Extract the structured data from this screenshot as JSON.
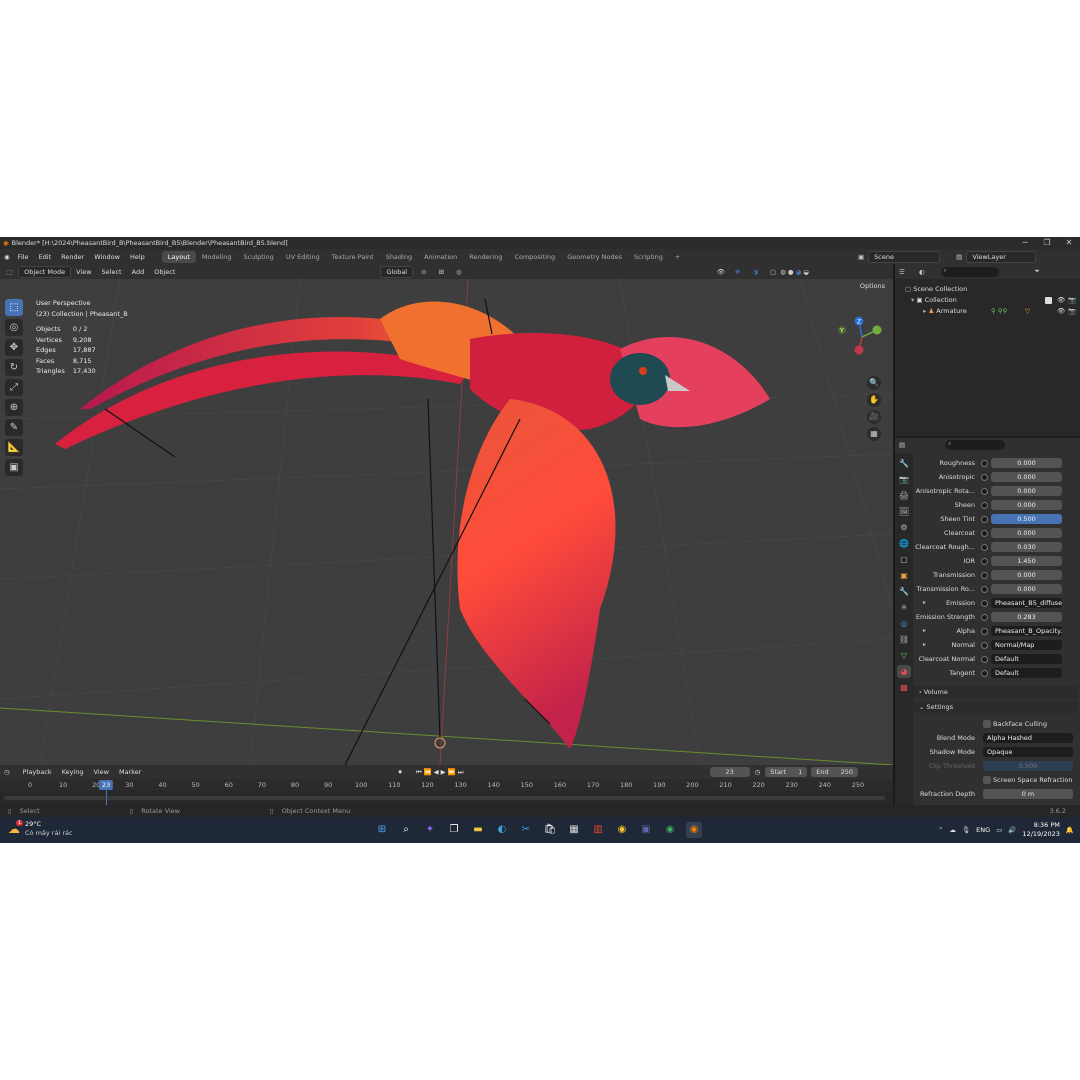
{
  "window": {
    "title": "Blender* [H:\\2024\\PheasantBird_B\\PheasantBird_B5\\Blender\\PheasantBird_B5.blend]",
    "minimize": "─",
    "maximize": "❐",
    "close": "✕"
  },
  "menu": [
    "File",
    "Edit",
    "Render",
    "Window",
    "Help"
  ],
  "workspaces": [
    "Layout",
    "Modeling",
    "Sculpting",
    "UV Editing",
    "Texture Paint",
    "Shading",
    "Animation",
    "Rendering",
    "Compositing",
    "Geometry Nodes",
    "Scripting"
  ],
  "active_workspace": "Layout",
  "add_workspace": "+",
  "scene": {
    "label": "Scene",
    "view_layer": "ViewLayer"
  },
  "viewport_header": {
    "mode": "Object Mode",
    "menus": [
      "View",
      "Select",
      "Add",
      "Object"
    ],
    "orientation": "Global",
    "options": "Options"
  },
  "viewport": {
    "view_name": "User Perspective",
    "collection_line": "(23) Collection | Pheasant_B",
    "stats": [
      {
        "label": "Objects",
        "value": "0 / 2"
      },
      {
        "label": "Vertices",
        "value": "9,208"
      },
      {
        "label": "Edges",
        "value": "17,887"
      },
      {
        "label": "Faces",
        "value": "8,715"
      },
      {
        "label": "Triangles",
        "value": "17,430"
      }
    ],
    "gizmo_axes": {
      "x": "X",
      "y": "Y",
      "z": "Z"
    }
  },
  "outliner": {
    "scene_collection": "Scene Collection",
    "collection": "Collection",
    "armature": "Armature"
  },
  "properties": [
    {
      "label": "Roughness",
      "value": "0.000"
    },
    {
      "label": "Anisotropic",
      "value": "0.000"
    },
    {
      "label": "Anisotropic Rota...",
      "value": "0.000"
    },
    {
      "label": "Sheen",
      "value": "0.000"
    },
    {
      "label": "Sheen Tint",
      "value": "0.500",
      "style": "blue"
    },
    {
      "label": "Clearcoat",
      "value": "0.000"
    },
    {
      "label": "Clearcoat Rough...",
      "value": "0.030"
    },
    {
      "label": "IOR",
      "value": "1.450"
    },
    {
      "label": "Transmission",
      "value": "0.000"
    },
    {
      "label": "Transmission Ro...",
      "value": "0.000"
    },
    {
      "label": "Emission",
      "value": "Pheasant_B5_diffuseOr...",
      "style": "dark",
      "expand": true
    },
    {
      "label": "Emission Strength",
      "value": "0.283"
    },
    {
      "label": "Alpha",
      "value": "Pheasant_B_Opacity.png",
      "style": "dark",
      "expand": true
    },
    {
      "label": "Normal",
      "value": "Normal/Map",
      "style": "dark",
      "expand": true
    },
    {
      "label": "Clearcoat Normal",
      "value": "Default",
      "style": "dark"
    },
    {
      "label": "Tangent",
      "value": "Default",
      "style": "dark"
    }
  ],
  "sections": {
    "volume": "Volume",
    "settings": "Settings"
  },
  "settings": {
    "backface_culling": "Backface Culling",
    "blend_mode_label": "Blend Mode",
    "blend_mode": "Alpha Hashed",
    "shadow_mode_label": "Shadow Mode",
    "shadow_mode": "Opaque",
    "clip_label": "Clip Threshold",
    "clip_value": "0.500",
    "ssr": "Screen Space Refraction",
    "refraction_depth_label": "Refraction Depth",
    "refraction_depth": "0 m"
  },
  "timeline": {
    "menus": [
      "Playback",
      "Keying",
      "View",
      "Marker"
    ],
    "current_frame": "23",
    "start_label": "Start",
    "start": "1",
    "end_label": "End",
    "end": "250",
    "ticks": [
      "0",
      "10",
      "20",
      "30",
      "40",
      "50",
      "60",
      "70",
      "80",
      "90",
      "100",
      "110",
      "120",
      "130",
      "140",
      "150",
      "160",
      "170",
      "180",
      "190",
      "200",
      "210",
      "220",
      "230",
      "240",
      "250"
    ]
  },
  "statusbar": {
    "select": "Select",
    "rotate": "Rotate View",
    "context": "Object Context Menu",
    "version": "3.6.2"
  },
  "taskbar": {
    "weather_temp": "29°C",
    "weather_desc": "Có mây rải rác",
    "language": "ENG",
    "time": "8:36 PM",
    "date": "12/19/2023",
    "notification_count": "1"
  },
  "colors": {
    "accent": "#4772b3",
    "viewport_bg": "#3e3e3e",
    "panel_bg": "#303030"
  }
}
